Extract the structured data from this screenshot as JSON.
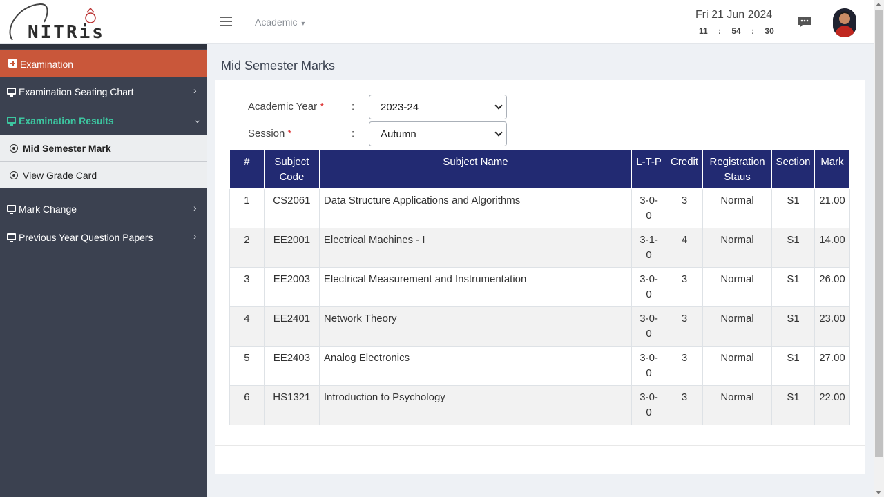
{
  "header": {
    "logo_text": "NITRis",
    "menu_academic": "Academic",
    "date": "Fri 21 Jun 2024",
    "time": {
      "hours": "11",
      "minutes": "54",
      "seconds": "30",
      "separator": ":"
    }
  },
  "sidebar": {
    "examination": "Examination",
    "seating_chart": "Examination Seating Chart",
    "results": "Examination Results",
    "mid_sem_mark": "Mid Semester Mark",
    "grade_card": "View Grade Card",
    "mark_change": "Mark Change",
    "question_papers": "Previous Year Question Papers"
  },
  "page": {
    "title": "Mid Semester Marks"
  },
  "form": {
    "academic_year_label": "Academic Year",
    "session_label": "Session",
    "required_mark": "*",
    "colon": ":",
    "academic_year_value": "2023-24",
    "session_value": "Autumn"
  },
  "table": {
    "headers": [
      "#",
      "Subject Code",
      "Subject Name",
      "L-T-P",
      "Credit",
      "Registration Staus",
      "Section",
      "Mark"
    ],
    "rows": [
      [
        "1",
        "CS2061",
        "Data Structure Applications and Algorithms",
        "3-0-0",
        "3",
        "Normal",
        "S1",
        "21.00"
      ],
      [
        "2",
        "EE2001",
        "Electrical Machines - I",
        "3-1-0",
        "4",
        "Normal",
        "S1",
        "14.00"
      ],
      [
        "3",
        "EE2003",
        "Electrical Measurement and Instrumentation",
        "3-0-0",
        "3",
        "Normal",
        "S1",
        "26.00"
      ],
      [
        "4",
        "EE2401",
        "Network Theory",
        "3-0-0",
        "3",
        "Normal",
        "S1",
        "23.00"
      ],
      [
        "5",
        "EE2403",
        "Analog Electronics",
        "3-0-0",
        "3",
        "Normal",
        "S1",
        "27.00"
      ],
      [
        "6",
        "HS1321",
        "Introduction to Psychology",
        "3-0-0",
        "3",
        "Normal",
        "S1",
        "22.00"
      ]
    ]
  },
  "colors": {
    "sidebar_bg": "#3b4150",
    "active_menu": "#c9573a",
    "accent_green": "#3cc6a0",
    "table_header": "#222a72"
  }
}
